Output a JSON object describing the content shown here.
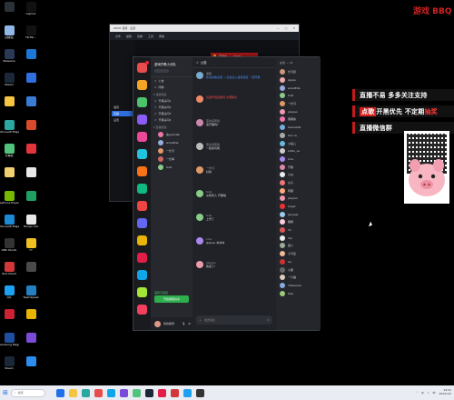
{
  "desktop": {
    "icons": [
      {
        "label": "",
        "name": "camera-app-icon",
        "color": "#2b3138"
      },
      {
        "label": "CapCut",
        "name": "capcut-icon",
        "color": "#111"
      },
      {
        "label": "回收站",
        "name": "recycle-bin-icon",
        "color": "#8fb8e8"
      },
      {
        "label": "TikTok...",
        "name": "tiktok-icon",
        "color": "#121212"
      },
      {
        "label": "WeGame",
        "name": "wegame-icon",
        "color": "#2a3a55"
      },
      {
        "label": "",
        "name": "browser-icon",
        "color": "#1c78d6"
      },
      {
        "label": "Steam",
        "name": "steam-icon",
        "color": "#1b2838"
      },
      {
        "label": "",
        "name": "app-icon",
        "color": "#2f6fe0"
      },
      {
        "label": "",
        "name": "folder-icon",
        "color": "#f5c542"
      },
      {
        "label": "",
        "name": "app-blue-icon",
        "color": "#3a7bd5"
      },
      {
        "label": "Microsoft Edge",
        "name": "edge-icon",
        "color": "#2aa7a0"
      },
      {
        "label": "",
        "name": "office-icon",
        "color": "#d84a2a"
      },
      {
        "label": "开黑啦",
        "name": "kook-icon",
        "color": "#52c37d"
      },
      {
        "label": "",
        "name": "music-icon",
        "color": "#e2343a"
      },
      {
        "label": "",
        "name": "doc-icon",
        "color": "#f0d070"
      },
      {
        "label": "",
        "name": "file-icon",
        "color": "#e8e8e8"
      },
      {
        "label": "GeForce Experience",
        "name": "nvidia-icon",
        "color": "#76b900"
      },
      {
        "label": "",
        "name": "green-app-icon",
        "color": "#20a060"
      },
      {
        "label": "Microsoft Edge",
        "name": "edge2-icon",
        "color": "#1a8ad4"
      },
      {
        "label": "Bongo Cat",
        "name": "bongo-icon",
        "color": "#e8e8e8"
      },
      {
        "label": "OBS Studio",
        "name": "obs-icon",
        "color": "#333"
      },
      {
        "label": "YY",
        "name": "yy-icon",
        "color": "#f0c020"
      },
      {
        "label": "Riot Client",
        "name": "riot-icon",
        "color": "#d13639"
      },
      {
        "label": "",
        "name": "game-icon",
        "color": "#4a4a4a"
      },
      {
        "label": "QQ",
        "name": "qq-icon",
        "color": "#1da1f2"
      },
      {
        "label": "TeamSpeak",
        "name": "teamspeak-icon",
        "color": "#2580c3"
      },
      {
        "label": "",
        "name": "red-app-icon",
        "color": "#cc2233"
      },
      {
        "label": "",
        "name": "yellow-app-icon",
        "color": "#e9b400"
      },
      {
        "label": "Samsung Magician",
        "name": "samsung-icon",
        "color": "#1e4fa0"
      },
      {
        "label": "",
        "name": "purple-app-icon",
        "color": "#7a4ad9"
      },
      {
        "label": "Steam",
        "name": "steam2-icon",
        "color": "#1b2838"
      },
      {
        "label": "",
        "name": "blue-tile-icon",
        "color": "#2d8cf0"
      }
    ]
  },
  "back_window": {
    "title": "KOOK 语音 · 设置",
    "controls": [
      "—",
      "□",
      "✕"
    ],
    "toolbar": [
      "文件",
      "编辑",
      "查看",
      "工具",
      "帮助"
    ],
    "left_items": [
      "语音",
      "直播",
      "设置"
    ],
    "banner": [
      "直播中",
      "|",
      "KOOK"
    ]
  },
  "chat": {
    "rail_colors": [
      "#e94c4c",
      "#f5a524",
      "#4cc26a",
      "#8b5cf6",
      "#ec4899",
      "#22c1dc",
      "#f97316",
      "#10b981",
      "#ef4444",
      "#6366f1",
      "#eab308",
      "#e11d48",
      "#0ea5e9",
      "#a3e635",
      "#f43f5e"
    ],
    "server_name": "游戏开黑小分队",
    "channels_text": [
      {
        "type": "row",
        "label": "公告"
      },
      {
        "type": "row",
        "label": "闲聊"
      },
      {
        "type": "group",
        "label": "▾ 语音频道"
      },
      {
        "type": "row",
        "label": "开黑房间1"
      },
      {
        "type": "row",
        "label": "开黑房间2"
      },
      {
        "type": "row",
        "label": "开黑房间3"
      },
      {
        "type": "row",
        "label": "开黑房间4"
      },
      {
        "type": "group",
        "label": "▾ 直播频道"
      }
    ],
    "voice_users": [
      {
        "name": "鬼guardsk",
        "color": "#e7a"
      },
      {
        "name": "wowlittle",
        "color": "#9ad"
      },
      {
        "name": "一长弓",
        "color": "#d96"
      },
      {
        "name": "一长串",
        "color": "#c66"
      },
      {
        "name": "Suki",
        "color": "#8c8"
      }
    ],
    "voice_status": "语音已连接",
    "voice_button": "开启屏幕共享",
    "user_name": "我的昵称",
    "header": "公告",
    "messages": [
      {
        "name": "游客",
        "time": "",
        "text": "新来的看这里 → 点击加入语音频道 一起开黑",
        "color": "#7ac",
        "accent": "link"
      },
      {
        "name": "",
        "time": "",
        "text": "请遵守频道规则 文明聊天",
        "color": "#e86",
        "accent": "red"
      },
      {
        "name": "茶水间老铁",
        "time": "",
        "text": "来开黑吗?",
        "color": "#c8a"
      },
      {
        "name": "茶水间老铁",
        "time": "",
        "text": "一起来玩吧",
        "color": "#bbb"
      },
      {
        "name": "一长弓",
        "time": "",
        "text": "好的",
        "color": "#d96"
      },
      {
        "name": "Suki",
        "time": "",
        "text": "@所有人 开黑啦",
        "color": "#8c8"
      },
      {
        "name": "Suki",
        "time": "",
        "text": "上号了",
        "color": "#8c8"
      },
      {
        "name": "kinu",
        "time": "",
        "text": "@jlove 冲冲冲",
        "color": "#a8e"
      },
      {
        "name": "jiaojiao",
        "time": "",
        "text": "我来了!",
        "color": "#e9a"
      }
    ],
    "input_placeholder": "发送消息",
    "members_header": "在线 — 31",
    "members": [
      {
        "name": "长弓叔",
        "color": "#c97"
      },
      {
        "name": "Apple",
        "color": "#eaa"
      },
      {
        "name": "wowlittle",
        "color": "#9ad"
      },
      {
        "name": "Suki",
        "color": "#8c8"
      },
      {
        "name": "一长弓",
        "color": "#d96"
      },
      {
        "name": "jiaojiao",
        "color": "#e9a"
      },
      {
        "name": "猪猪侠",
        "color": "#e7a"
      },
      {
        "name": "GameLIfe",
        "color": "#7ad"
      },
      {
        "name": "Ooo la",
        "color": "#aaa"
      },
      {
        "name": "小鱼儿",
        "color": "#6bd"
      },
      {
        "name": "LilWu_Le",
        "color": "#ccc"
      },
      {
        "name": "kinu",
        "color": "#a8e"
      },
      {
        "name": "开黑",
        "color": "#d8a"
      },
      {
        "name": "小白",
        "color": "#eee"
      },
      {
        "name": "丸子",
        "color": "#e77"
      },
      {
        "name": "阿狸",
        "color": "#fa7"
      },
      {
        "name": "jiaojiao",
        "color": "#e9a"
      },
      {
        "name": "Sugar",
        "color": "#e33"
      },
      {
        "name": "jwxyear",
        "color": "#9ce"
      },
      {
        "name": "糖果",
        "color": "#fcd"
      },
      {
        "name": "YA",
        "color": "#d55"
      },
      {
        "name": "Vip",
        "color": "#eee"
      },
      {
        "name": "路人",
        "color": "#9a9"
      },
      {
        "name": "小可爱",
        "color": "#eb9"
      },
      {
        "name": "Aa",
        "color": "#c33"
      },
      {
        "name": "小黑",
        "color": "#666"
      },
      {
        "name": "一只猫",
        "color": "#dcb"
      },
      {
        "name": "YKGame4",
        "color": "#8ad"
      },
      {
        "name": "Kiwi",
        "color": "#9c7"
      }
    ]
  },
  "promo": {
    "line1": "直播不易 多多关注支持",
    "line2_hl": "点歌",
    "line2_mid": "开黑优先 不定期",
    "line2_red": "抽奖",
    "line3": "直播微信群",
    "logo": "游戏 BBQ"
  },
  "taskbar": {
    "search_placeholder": "搜索",
    "app_colors": [
      "#1f6feb",
      "#f5c542",
      "#2aa7a0",
      "#e94c4c",
      "#0ea5e9",
      "#7a4ad9",
      "#52c37d",
      "#1b2838",
      "#e11d48",
      "#d13639",
      "#1da1f2",
      "#333"
    ],
    "tray_text": "中",
    "time": "19:52",
    "date": "2022/1/5"
  }
}
